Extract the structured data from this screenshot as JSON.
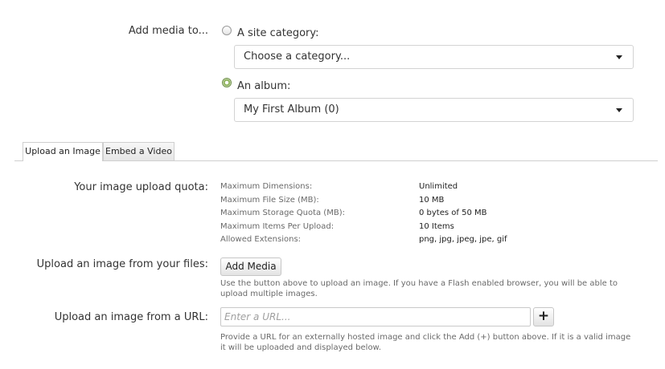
{
  "add_media": {
    "label": "Add media to...",
    "site_category": {
      "label": "A site category:",
      "selected": false,
      "select_value": "Choose a category..."
    },
    "album": {
      "label": "An album:",
      "selected": true,
      "select_value": "My First Album (0)"
    }
  },
  "tabs": [
    {
      "label": "Upload an Image",
      "active": true
    },
    {
      "label": "Embed a Video",
      "active": false
    }
  ],
  "quota": {
    "label": "Your image upload quota:",
    "rows": [
      {
        "key": "Maximum Dimensions:",
        "value": "Unlimited"
      },
      {
        "key": "Maximum File Size (MB):",
        "value": "10 MB"
      },
      {
        "key": "Maximum Storage Quota (MB):",
        "value": "0 bytes of 50 MB"
      },
      {
        "key": "Maximum Items Per Upload:",
        "value": "10 Items"
      },
      {
        "key": "Allowed Extensions:",
        "value": "png, jpg, jpeg, jpe, gif"
      }
    ]
  },
  "upload_files": {
    "label": "Upload an image from your files:",
    "button_label": "Add Media",
    "help": "Use the button above to upload an image. If you have a Flash enabled browser, you will be able to upload multiple images."
  },
  "upload_url": {
    "label": "Upload an image from a URL:",
    "placeholder": "Enter a URL...",
    "value": "",
    "add_button_label": "+",
    "help": "Provide a URL for an externally hosted image and click the Add (+) button above. If it is a valid image it will be uploaded and displayed below."
  },
  "icons": {
    "select_caret": "chevron-down-icon",
    "add": "plus-icon"
  }
}
